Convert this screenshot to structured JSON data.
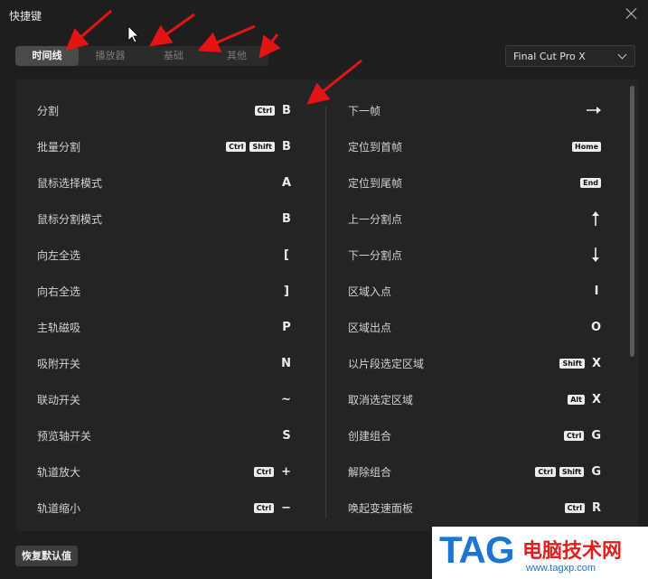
{
  "window": {
    "title": "快捷键"
  },
  "tabs": [
    "时间线",
    "播放器",
    "基础",
    "其他"
  ],
  "preset": {
    "value": "Final Cut Pro X"
  },
  "shortcuts_left": [
    {
      "label": "分割",
      "mods": [
        "Ctrl"
      ],
      "key": "B"
    },
    {
      "label": "批量分割",
      "mods": [
        "Ctrl",
        "Shift"
      ],
      "key": "B"
    },
    {
      "label": "鼠标选择模式",
      "mods": [],
      "key": "A"
    },
    {
      "label": "鼠标分割模式",
      "mods": [],
      "key": "B"
    },
    {
      "label": "向左全选",
      "mods": [],
      "key": "["
    },
    {
      "label": "向右全选",
      "mods": [],
      "key": "]"
    },
    {
      "label": "主轨磁吸",
      "mods": [],
      "key": "P"
    },
    {
      "label": "吸附开关",
      "mods": [],
      "key": "N"
    },
    {
      "label": "联动开关",
      "mods": [],
      "key": "~"
    },
    {
      "label": "预览轴开关",
      "mods": [],
      "key": "S"
    },
    {
      "label": "轨道放大",
      "mods": [
        "Ctrl"
      ],
      "key": "+"
    },
    {
      "label": "轨道缩小",
      "mods": [
        "Ctrl"
      ],
      "key": "−"
    }
  ],
  "shortcuts_right": [
    {
      "label": "下一帧",
      "mods": [],
      "key": "",
      "icon": "arrow-right-icon"
    },
    {
      "label": "定位到首帧",
      "mods": [
        "Home"
      ],
      "key": ""
    },
    {
      "label": "定位到尾帧",
      "mods": [
        "End"
      ],
      "key": ""
    },
    {
      "label": "上一分割点",
      "mods": [],
      "key": "",
      "icon": "arrow-up-icon"
    },
    {
      "label": "下一分割点",
      "mods": [],
      "key": "",
      "icon": "arrow-down-icon"
    },
    {
      "label": "区域入点",
      "mods": [],
      "key": "I"
    },
    {
      "label": "区域出点",
      "mods": [],
      "key": "O"
    },
    {
      "label": "以片段选定区域",
      "mods": [
        "Shift"
      ],
      "key": "X"
    },
    {
      "label": "取消选定区域",
      "mods": [
        "Alt"
      ],
      "key": "X"
    },
    {
      "label": "创建组合",
      "mods": [
        "Ctrl"
      ],
      "key": "G"
    },
    {
      "label": "解除组合",
      "mods": [
        "Ctrl",
        "Shift"
      ],
      "key": "G"
    },
    {
      "label": "唤起变速面板",
      "mods": [
        "Ctrl"
      ],
      "key": "R"
    }
  ],
  "reset_button": {
    "label": "恢复默认值"
  },
  "watermark": {
    "tag": "TAG",
    "name": "电脑技术网",
    "url": "www.tagxp.com"
  }
}
